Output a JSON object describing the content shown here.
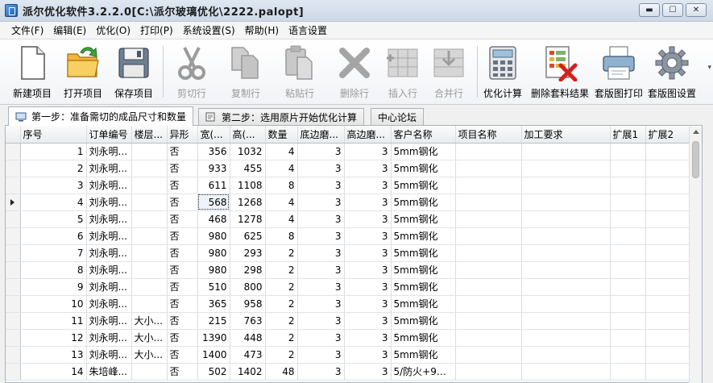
{
  "window": {
    "title": "派尔优化软件3.2.2.0[C:\\派尔玻璃优化\\2222.palopt]",
    "buttons": {
      "minimize": "▬",
      "maximize": "☐",
      "close": "✕"
    }
  },
  "menu": [
    "文件(F)",
    "编辑(E)",
    "优化(O)",
    "打印(P)",
    "系统设置(S)",
    "帮助(H)",
    "语言设置"
  ],
  "toolbar": {
    "new": "新建项目",
    "open": "打开项目",
    "save": "保存项目",
    "cut": "剪切行",
    "copy": "复制行",
    "paste": "粘贴行",
    "delete": "删除行",
    "insert": "插入行",
    "merge": "合并行",
    "optimize": "优化计算",
    "delete_result": "删除套料结果",
    "print_layout": "套版图打印",
    "layout_settings": "套版图设置",
    "overflow": "▾"
  },
  "tabs": [
    "第一步：准备需切的成品尺寸和数量",
    "第二步：选用原片开始优化计算",
    "中心论坛"
  ],
  "grid": {
    "columns": [
      "序号",
      "订单编号",
      "楼层...",
      "异形",
      "宽(...",
      "高(...",
      "数量",
      "底边磨...",
      "高边磨...",
      "客户名称",
      "项目名称",
      "加工要求",
      "扩展1",
      "扩展2"
    ],
    "rows": [
      [
        "1",
        "刘永明...",
        "",
        "否",
        "356",
        "1032",
        "4",
        "3",
        "3",
        "5mm钢化",
        "",
        "",
        "",
        ""
      ],
      [
        "2",
        "刘永明...",
        "",
        "否",
        "933",
        "455",
        "4",
        "3",
        "3",
        "5mm钢化",
        "",
        "",
        "",
        ""
      ],
      [
        "3",
        "刘永明...",
        "",
        "否",
        "611",
        "1108",
        "8",
        "3",
        "3",
        "5mm钢化",
        "",
        "",
        "",
        ""
      ],
      [
        "4",
        "刘永明...",
        "",
        "否",
        "568",
        "1268",
        "4",
        "3",
        "3",
        "5mm钢化",
        "",
        "",
        "",
        ""
      ],
      [
        "5",
        "刘永明...",
        "",
        "否",
        "468",
        "1278",
        "4",
        "3",
        "3",
        "5mm钢化",
        "",
        "",
        "",
        ""
      ],
      [
        "6",
        "刘永明...",
        "",
        "否",
        "980",
        "625",
        "8",
        "3",
        "3",
        "5mm钢化",
        "",
        "",
        "",
        ""
      ],
      [
        "7",
        "刘永明...",
        "",
        "否",
        "980",
        "293",
        "2",
        "3",
        "3",
        "5mm钢化",
        "",
        "",
        "",
        ""
      ],
      [
        "8",
        "刘永明...",
        "",
        "否",
        "980",
        "298",
        "2",
        "3",
        "3",
        "5mm钢化",
        "",
        "",
        "",
        ""
      ],
      [
        "9",
        "刘永明...",
        "",
        "否",
        "510",
        "800",
        "2",
        "3",
        "3",
        "5mm钢化",
        "",
        "",
        "",
        ""
      ],
      [
        "10",
        "刘永明...",
        "",
        "否",
        "365",
        "958",
        "2",
        "3",
        "3",
        "5mm钢化",
        "",
        "",
        "",
        ""
      ],
      [
        "11",
        "刘永明...",
        "大小...",
        "否",
        "215",
        "763",
        "2",
        "3",
        "3",
        "5mm钢化",
        "",
        "",
        "",
        ""
      ],
      [
        "12",
        "刘永明...",
        "大小...",
        "否",
        "1390",
        "448",
        "2",
        "3",
        "3",
        "5mm钢化",
        "",
        "",
        "",
        ""
      ],
      [
        "13",
        "刘永明...",
        "大小...",
        "否",
        "1400",
        "473",
        "2",
        "3",
        "3",
        "5mm钢化",
        "",
        "",
        "",
        ""
      ],
      [
        "14",
        "朱培峰...",
        "",
        "否",
        "502",
        "1402",
        "48",
        "3",
        "3",
        "5/防火+9+...",
        "",
        "",
        "",
        ""
      ]
    ]
  }
}
